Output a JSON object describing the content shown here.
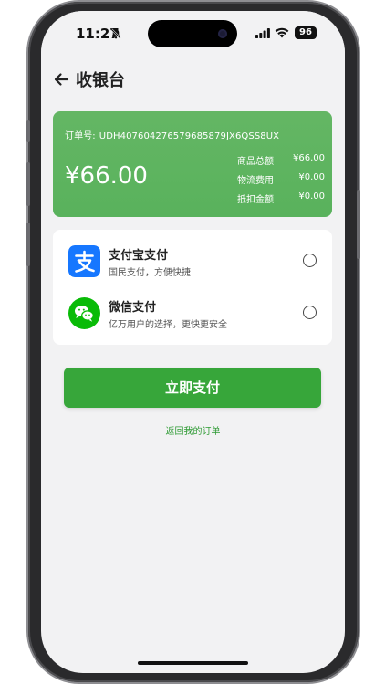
{
  "status_bar": {
    "time": "11:27",
    "battery": "96",
    "icons": [
      "bell-muted-icon",
      "cellular-signal-icon",
      "wifi-icon",
      "battery-icon"
    ]
  },
  "header": {
    "title": "收银台",
    "back_icon": "arrow-left-icon"
  },
  "order": {
    "order_no_label": "订单号:",
    "order_no": "UDH407604276579685879JX6QSS8UX",
    "total": "¥66.00",
    "rows": [
      {
        "label": "商品总额",
        "value": "¥66.00"
      },
      {
        "label": "物流费用",
        "value": "¥0.00"
      },
      {
        "label": "抵扣金额",
        "value": "¥0.00"
      }
    ]
  },
  "payment_methods": [
    {
      "name": "支付宝支付",
      "desc": "国民支付，方便快捷",
      "icon": "alipay-icon",
      "selected": false
    },
    {
      "name": "微信支付",
      "desc": "亿万用户的选择，更快更安全",
      "icon": "wechat-pay-icon",
      "selected": false
    }
  ],
  "actions": {
    "pay_label": "立即支付",
    "back_orders_label": "返回我的订单"
  },
  "colors": {
    "brand_green": "#37a63a",
    "card_green": "#5fb45f",
    "alipay_blue": "#1677ff",
    "wechat_green": "#09bb07",
    "background": "#f2f2f3"
  }
}
